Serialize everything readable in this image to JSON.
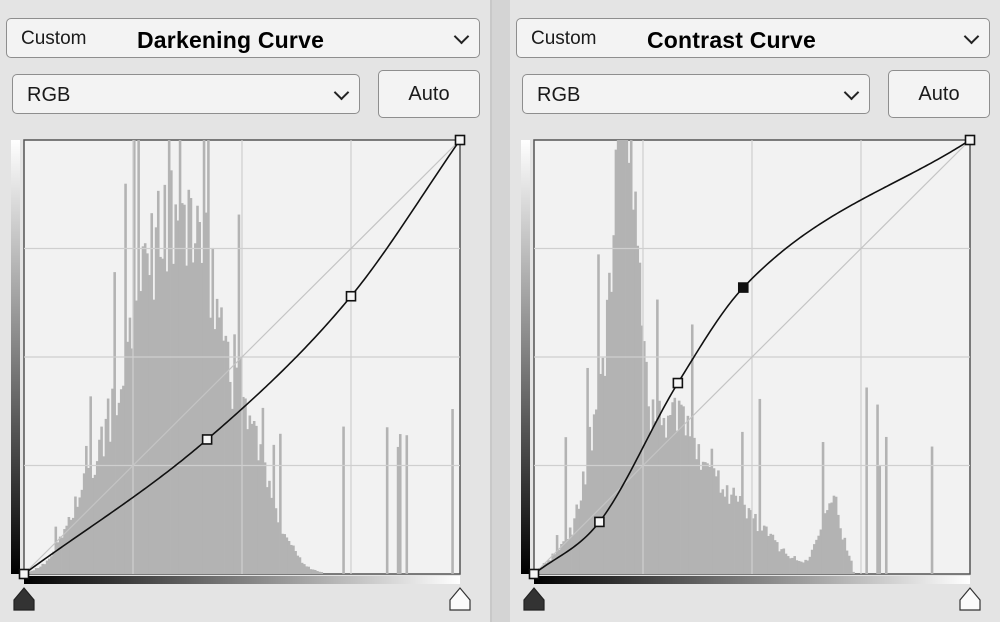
{
  "left": {
    "preset_value": "Custom",
    "preset_title": "Darkening Curve",
    "channel": "RGB",
    "auto_label": "Auto",
    "curve_points": [
      [
        0,
        0
      ],
      [
        42,
        31
      ],
      [
        75,
        64
      ],
      [
        100,
        100
      ]
    ],
    "selected_point": -1
  },
  "right": {
    "preset_value": "Custom",
    "preset_title": "Contrast Curve",
    "channel": "RGB",
    "auto_label": "Auto",
    "curve_points": [
      [
        0,
        0
      ],
      [
        15,
        12
      ],
      [
        33,
        44
      ],
      [
        48,
        66
      ],
      [
        100,
        100
      ]
    ],
    "selected_point": 3
  },
  "colors": {
    "panel_bg": "#e4e4e4",
    "graph_bg": "#f2f2f2",
    "histogram": "#b3b3b3",
    "curve": "#111111",
    "grid": "#cfcfcf"
  },
  "icons": [
    "chevron-down-icon",
    "black-point-slider-icon",
    "white-point-slider-icon"
  ]
}
